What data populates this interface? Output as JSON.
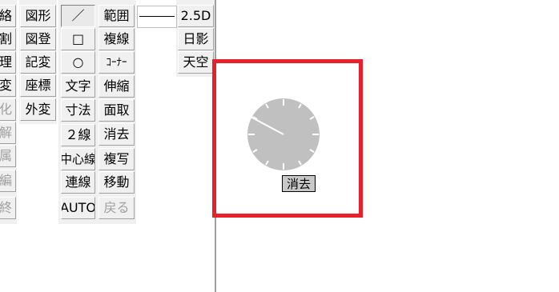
{
  "toolbar": {
    "col0": [
      {
        "label": "絡",
        "disabled": false
      },
      {
        "label": "割",
        "disabled": false
      },
      {
        "label": "理",
        "disabled": false
      },
      {
        "label": "変",
        "disabled": false
      },
      {
        "label": "化",
        "disabled": true
      },
      {
        "label": "解",
        "disabled": true
      },
      {
        "label": "属",
        "disabled": true
      },
      {
        "label": "編",
        "disabled": true
      },
      {
        "label": "終",
        "disabled": true
      }
    ],
    "col1": [
      {
        "label": "図形"
      },
      {
        "label": "図登"
      },
      {
        "label": "記変"
      },
      {
        "label": "座標"
      },
      {
        "label": "外変"
      }
    ],
    "col2": [
      {
        "label": "／",
        "name": "line-tool-button",
        "pressed": true
      },
      {
        "label": "□",
        "name": "rectangle-tool-button"
      },
      {
        "label": "○",
        "name": "circle-tool-button"
      },
      {
        "label": "文字",
        "name": "text-tool-button"
      },
      {
        "label": "寸法",
        "name": "dimension-tool-button"
      },
      {
        "label": "２線",
        "name": "double-line-tool-button"
      },
      {
        "label": "中心線",
        "name": "centerline-tool-button"
      },
      {
        "label": "連線",
        "name": "continuous-line-tool-button"
      },
      {
        "label": "AUTO",
        "name": "auto-tool-button"
      }
    ],
    "col3": [
      {
        "label": "範囲",
        "name": "range-tool-button"
      },
      {
        "label": "複線",
        "name": "parallel-line-tool-button"
      },
      {
        "label": "ｺｰﾅｰ",
        "name": "corner-tool-button"
      },
      {
        "label": "伸縮",
        "name": "stretch-tool-button"
      },
      {
        "label": "面取",
        "name": "chamfer-tool-button"
      },
      {
        "label": "消去",
        "name": "erase-tool-button"
      },
      {
        "label": "複写",
        "name": "copy-tool-button"
      },
      {
        "label": "移動",
        "name": "move-tool-button"
      },
      {
        "label": "戻る",
        "name": "undo-tool-button",
        "disabled": true
      }
    ],
    "col4": [
      {
        "label": "2.5D",
        "name": "2-5d-view-button"
      },
      {
        "label": "日影",
        "name": "sun-shadow-button"
      },
      {
        "label": "天空",
        "name": "sky-factor-button"
      }
    ]
  },
  "tooltip": {
    "label": "消去"
  },
  "colors": {
    "highlight": "#e8202a",
    "clock_face": "#c0c0c0",
    "button_face": "#f0f0f0",
    "disabled_text": "#a0a0a0"
  }
}
